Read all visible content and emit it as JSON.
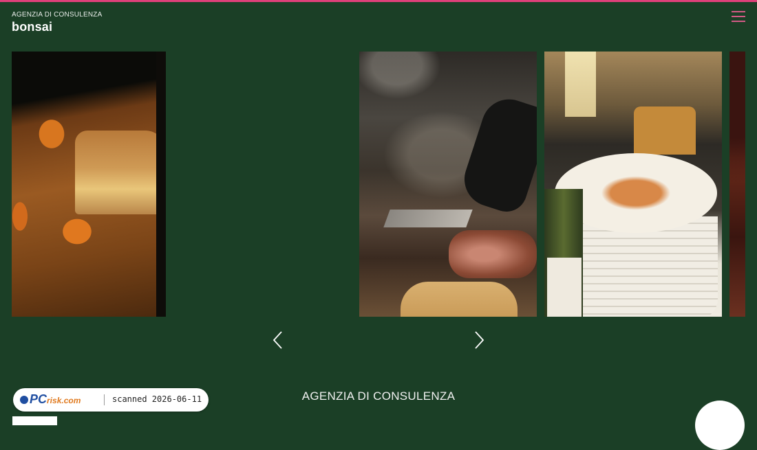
{
  "header": {
    "subtitle": "AGENZIA DI CONSULENZA",
    "brand": "bonsai",
    "menu_icon": "hamburger-menu-icon",
    "accent_color": "#e0407a"
  },
  "gallery": {
    "slides": [
      {
        "subject": "apricot-cake-photo"
      },
      {
        "subject": "griddle-cooking-photo"
      },
      {
        "subject": "pasta-plate-photo"
      },
      {
        "subject": "partial-food-photo"
      }
    ],
    "prev_icon": "chevron-left-icon",
    "next_icon": "chevron-right-icon"
  },
  "footer": {
    "title": "AGENZIA DI CONSULENZA"
  },
  "watermark": {
    "logo_main": "PC",
    "logo_sub": "risk.com",
    "text": "scanned 2026-06-11"
  },
  "colors": {
    "background": "#1b3f26",
    "menu": "#d45a86"
  }
}
